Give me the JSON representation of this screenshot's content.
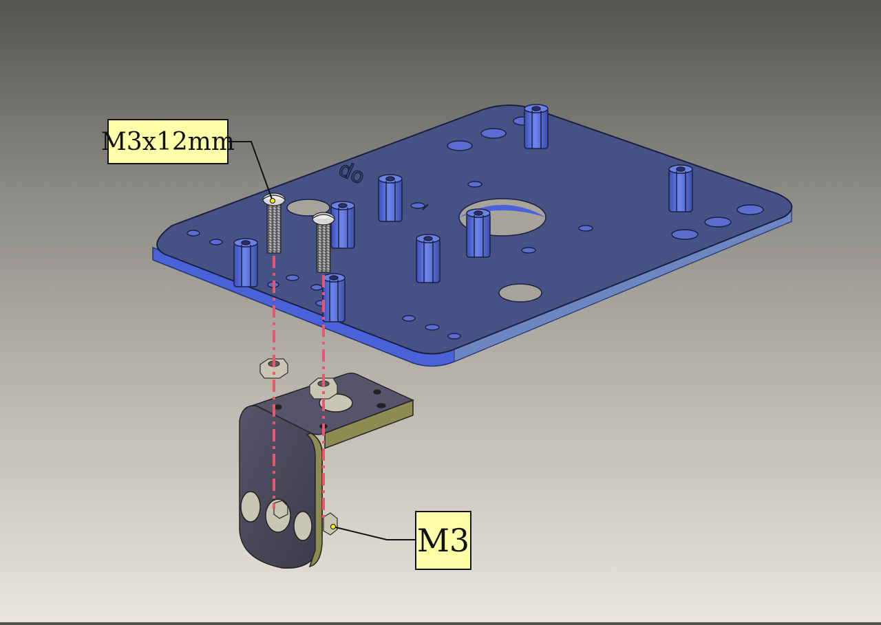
{
  "callouts": {
    "screw_label": "M3x12mm",
    "nut_label": "M3"
  },
  "plate_engraving": "do",
  "colors": {
    "plate_top": "#465285",
    "plate_edge": "#4a62d8",
    "standoff": "#5570d8",
    "bracket": "#4b4a58",
    "bracket_edge": "#8d8a52",
    "callout_fill": "#ffffaa",
    "assembly_line": "#e8566f",
    "hardware": "#c9c7b4"
  }
}
